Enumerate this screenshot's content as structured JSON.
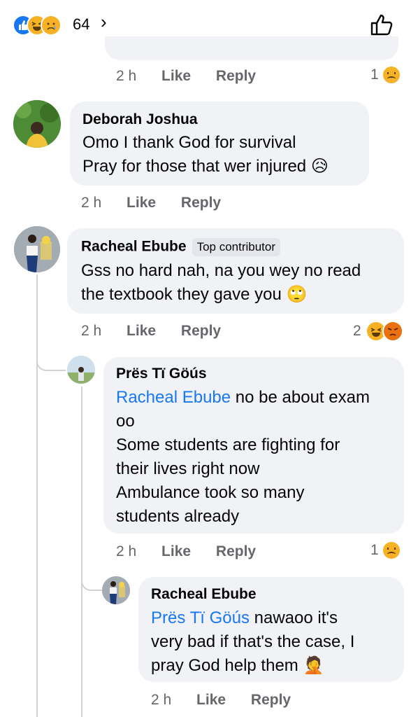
{
  "header": {
    "reaction_count": "64",
    "chevron": "›"
  },
  "comments": [
    {
      "id": "prev",
      "time": "2 h",
      "like": "Like",
      "reply": "Reply",
      "reaction_count": "1"
    },
    {
      "id": "c1",
      "author": "Deborah Joshua",
      "lines": [
        "Omo I thank God for survival",
        "Pray for those that wer injured 😥"
      ],
      "time": "2 h",
      "like": "Like",
      "reply": "Reply"
    },
    {
      "id": "c2",
      "author": "Racheal Ebube",
      "badge": "Top contributor",
      "lines": [
        "Gss no hard nah, na you wey no read",
        "the textbook they gave you 🙄"
      ],
      "time": "2 h",
      "like": "Like",
      "reply": "Reply",
      "reaction_count": "2"
    },
    {
      "id": "c3",
      "author": "Prës Tï Göús",
      "mention": "Racheal Ebube",
      "first_line_rest": " no be about exam",
      "lines": [
        "oo",
        "Some students are fighting for",
        "their lives right now",
        "Ambulance took so many",
        "students already"
      ],
      "time": "2 h",
      "like": "Like",
      "reply": "Reply",
      "reaction_count": "1"
    },
    {
      "id": "c4",
      "author": "Racheal Ebube",
      "mention": "Prës Tï Göús",
      "first_line_rest": " nawaoo it's",
      "lines": [
        "very bad if that's the case, I",
        "pray God help them 🤦"
      ],
      "time": "2 h",
      "like": "Like",
      "reply": "Reply"
    }
  ]
}
